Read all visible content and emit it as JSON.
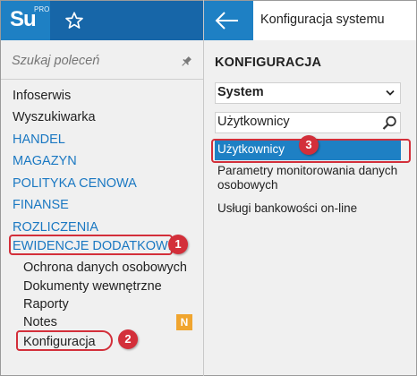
{
  "colors": {
    "accent_blue": "#1e80c4",
    "dark_blue": "#1766a8",
    "category_blue": "#1a78c2",
    "callout_red": "#d32f3a",
    "badge_orange": "#f0a52f",
    "panel_bg": "#f0f0f0"
  },
  "logo": {
    "text": "Su",
    "superscript": "PRO"
  },
  "left": {
    "favorites_icon": "star-icon",
    "search_placeholder": "Szukaj poleceń",
    "pin_icon": "pin-icon",
    "menu": [
      {
        "label": "Infoserwis",
        "kind": "plain"
      },
      {
        "label": "Wyszukiwarka",
        "kind": "plain"
      },
      {
        "label": "HANDEL",
        "kind": "category"
      },
      {
        "label": "MAGAZYN",
        "kind": "category"
      },
      {
        "label": "POLITYKA CENOWA",
        "kind": "category"
      },
      {
        "label": "FINANSE",
        "kind": "category"
      },
      {
        "label": "ROZLICZENIA",
        "kind": "category"
      },
      {
        "label": "EWIDENCJE DODATKOWE",
        "kind": "category"
      },
      {
        "label": "Ochrona danych osobowych",
        "kind": "sub"
      },
      {
        "label": "Dokumenty wewnętrzne",
        "kind": "sub"
      },
      {
        "label": "Raporty",
        "kind": "sub"
      },
      {
        "label": "Notes",
        "kind": "sub"
      },
      {
        "label": "Konfiguracja",
        "kind": "sub"
      }
    ],
    "notes_badge": "N"
  },
  "right": {
    "back_icon": "arrow-left-icon",
    "title": "Konfiguracja systemu",
    "section": "KONFIGURACJA",
    "select_value": "System",
    "filter_value": "Użytkownicy",
    "results": [
      {
        "label": "Użytkownicy",
        "selected": true
      },
      {
        "label": "Parametry monitorowania danych osobowych",
        "selected": false
      },
      {
        "label": "Usługi bankowości on-line",
        "selected": false
      }
    ]
  },
  "callouts": [
    "1",
    "2",
    "3"
  ]
}
